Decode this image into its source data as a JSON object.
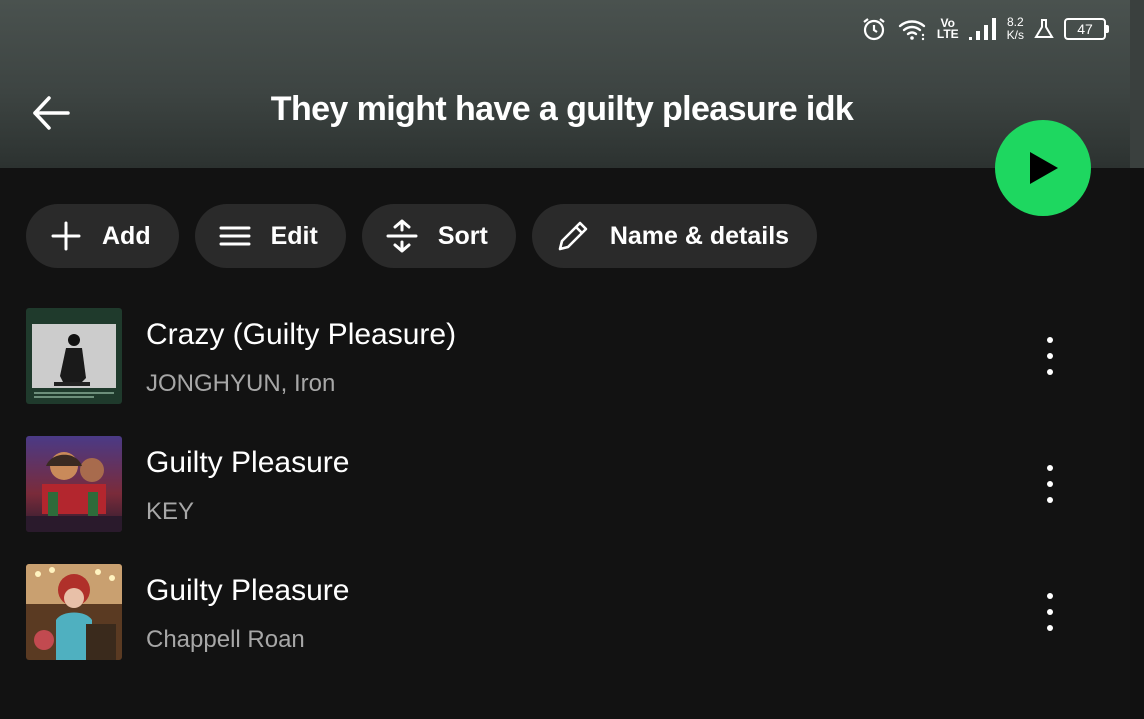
{
  "status_bar": {
    "icons": [
      "alarm-icon",
      "wifi-icon",
      "volte-indicator",
      "signal-icon",
      "data-speed",
      "flask-icon",
      "battery-icon"
    ],
    "volte_top": "Vo",
    "volte_bottom": "LTE",
    "speed_value": "8.2",
    "speed_unit": "K/s",
    "battery_level": "47"
  },
  "header": {
    "back_icon": "arrow-left-icon",
    "title": "They might have a guilty pleasure idk",
    "play_icon": "play-icon"
  },
  "actions": [
    {
      "label": "Add",
      "icon": "plus-icon"
    },
    {
      "label": "Edit",
      "icon": "lines-icon"
    },
    {
      "label": "Sort",
      "icon": "sort-icon"
    },
    {
      "label": "Name & details",
      "icon": "pencil-icon"
    }
  ],
  "tracks": [
    {
      "title": "Crazy (Guilty Pleasure)",
      "artist": "JONGHYUN, Iron"
    },
    {
      "title": "Guilty Pleasure",
      "artist": "KEY"
    },
    {
      "title": "Guilty Pleasure",
      "artist": "Chappell Roan"
    }
  ],
  "colors": {
    "accent": "#1ed760",
    "background": "#121212",
    "chip": "#2a2a2a",
    "secondary_text": "#a7a7a7"
  }
}
